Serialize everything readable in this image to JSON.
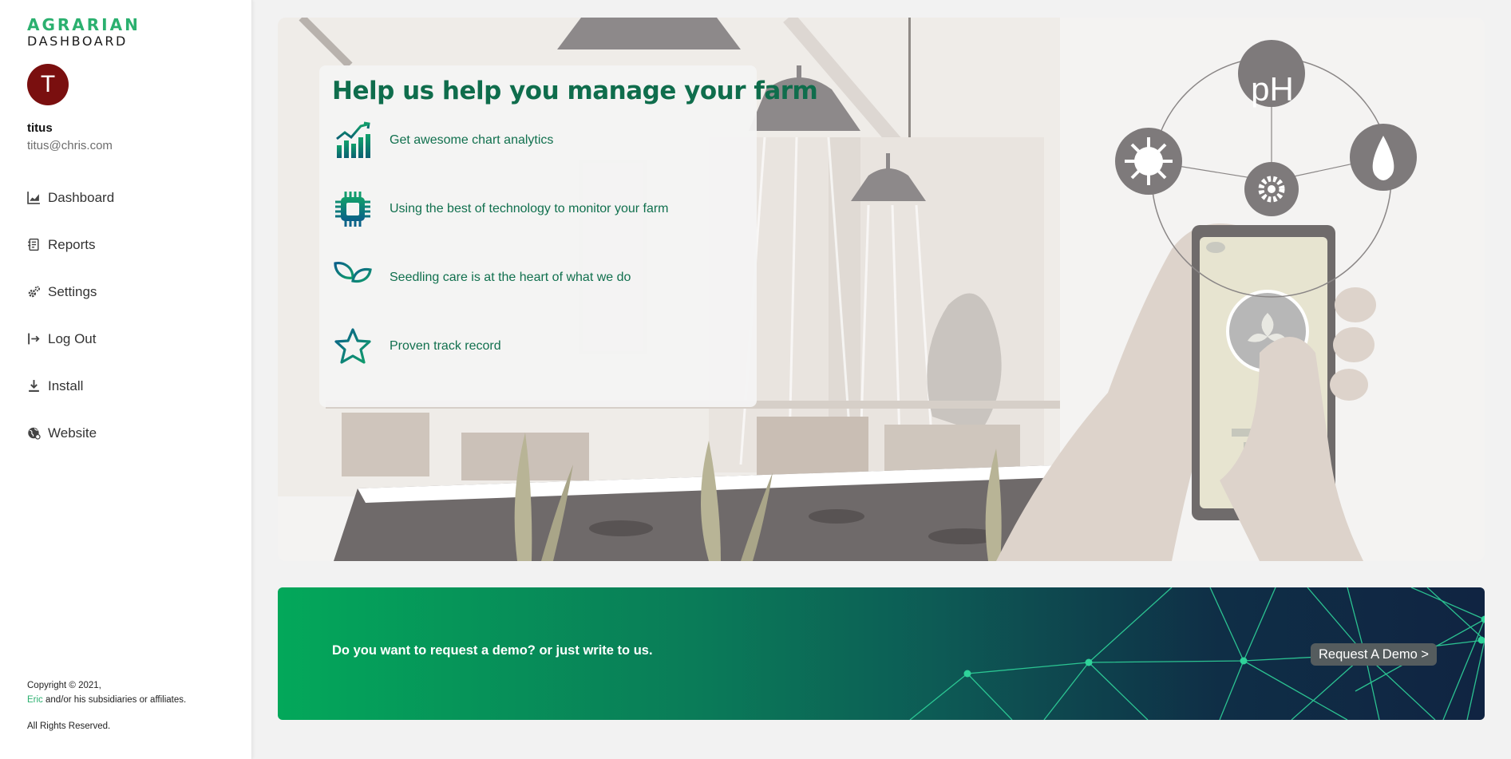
{
  "sidebar": {
    "logo": {
      "line1": "AGRARIAN",
      "line2": "DASHBOARD"
    },
    "user": {
      "initial": "T",
      "name": "titus",
      "email": "titus@chris.com"
    },
    "nav": [
      {
        "label": "Dashboard",
        "icon": "chart-icon"
      },
      {
        "label": "Reports",
        "icon": "report-icon"
      },
      {
        "label": "Settings",
        "icon": "gear-icon"
      },
      {
        "label": "Log Out",
        "icon": "logout-icon"
      },
      {
        "label": "Install",
        "icon": "download-icon"
      },
      {
        "label": "Website",
        "icon": "globe-icon"
      }
    ],
    "copyright": {
      "line1": "Copyright © 2021,",
      "link": "Eric",
      "line2_rest": " and/or his subsidiaries or affiliates.",
      "line3": "All Rights Reserved."
    }
  },
  "hero": {
    "title": "Help us help you manage your farm",
    "features": [
      {
        "text": "Get awesome chart analytics",
        "icon": "bar-chart-icon"
      },
      {
        "text": "Using the best of technology to monitor your farm",
        "icon": "chip-icon"
      },
      {
        "text": "Seedling care is at the heart of what we do",
        "icon": "seedling-icon"
      },
      {
        "text": "Proven track record",
        "icon": "star-icon"
      }
    ],
    "illustration_label": "pH"
  },
  "banner": {
    "text": "Do you want to request a demo? or just write to us.",
    "button": "Request A Demo >"
  },
  "colors": {
    "brand_green": "#2bb06f",
    "title_green": "#0f6d4c",
    "avatar": "#7a0f0f",
    "banner_start": "#03a85a",
    "banner_end": "#102442"
  }
}
